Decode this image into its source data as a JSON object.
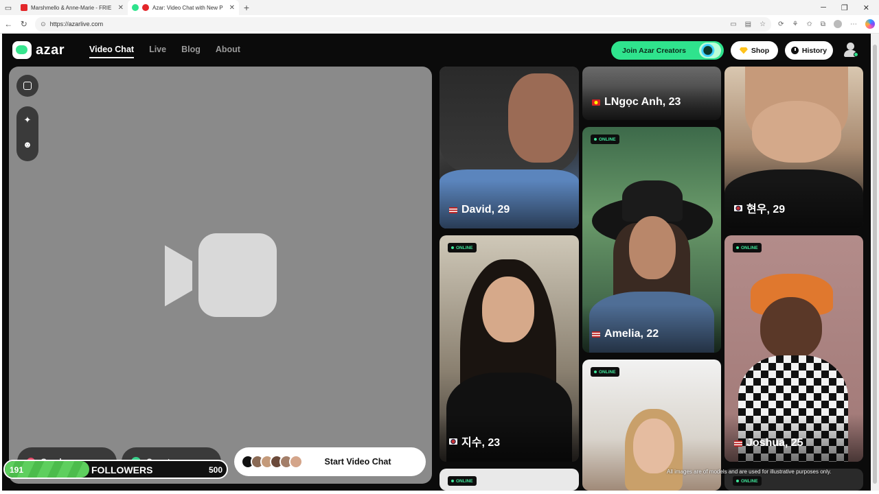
{
  "browser": {
    "tabs": [
      {
        "title": "Marshmello & Anne-Marie - FRIE",
        "favicon_color": "#e3262a",
        "active": false
      },
      {
        "title": "Azar: Video Chat with New P",
        "favicon_color": "#e3262a",
        "active": true
      }
    ],
    "new_tab": "+",
    "url": "https://azarlive.com"
  },
  "header": {
    "logo": "azar",
    "nav": [
      "Video Chat",
      "Live",
      "Blog",
      "About"
    ],
    "creators_label": "Join Azar Creators",
    "shop_label": "Shop",
    "history_label": "History"
  },
  "video_panel": {
    "gender_label": "Gender",
    "country_label": "Country",
    "start_label": "Start Video Chat"
  },
  "followers": {
    "current": "191",
    "label": "FOLLOWERS",
    "goal": "500",
    "progress": 0.38
  },
  "online_label": "ONLINE",
  "profiles": [
    {
      "name": "David, 29",
      "flag": "us"
    },
    {
      "name": "LNgọc Anh, 23",
      "flag": "vn"
    },
    {
      "name": "현우, 29",
      "flag": "kr"
    },
    {
      "name": "Amelia, 22",
      "flag": "us"
    },
    {
      "name": "지수, 23",
      "flag": "kr"
    },
    {
      "name": "Joshua, 25",
      "flag": "us"
    }
  ],
  "disclaimer": "All images are of models and are used for illustrative purposes only.",
  "colors": {
    "accent": "#2fe38d",
    "panel": "#8a8a8a",
    "page_bg": "#0b0b0b"
  }
}
